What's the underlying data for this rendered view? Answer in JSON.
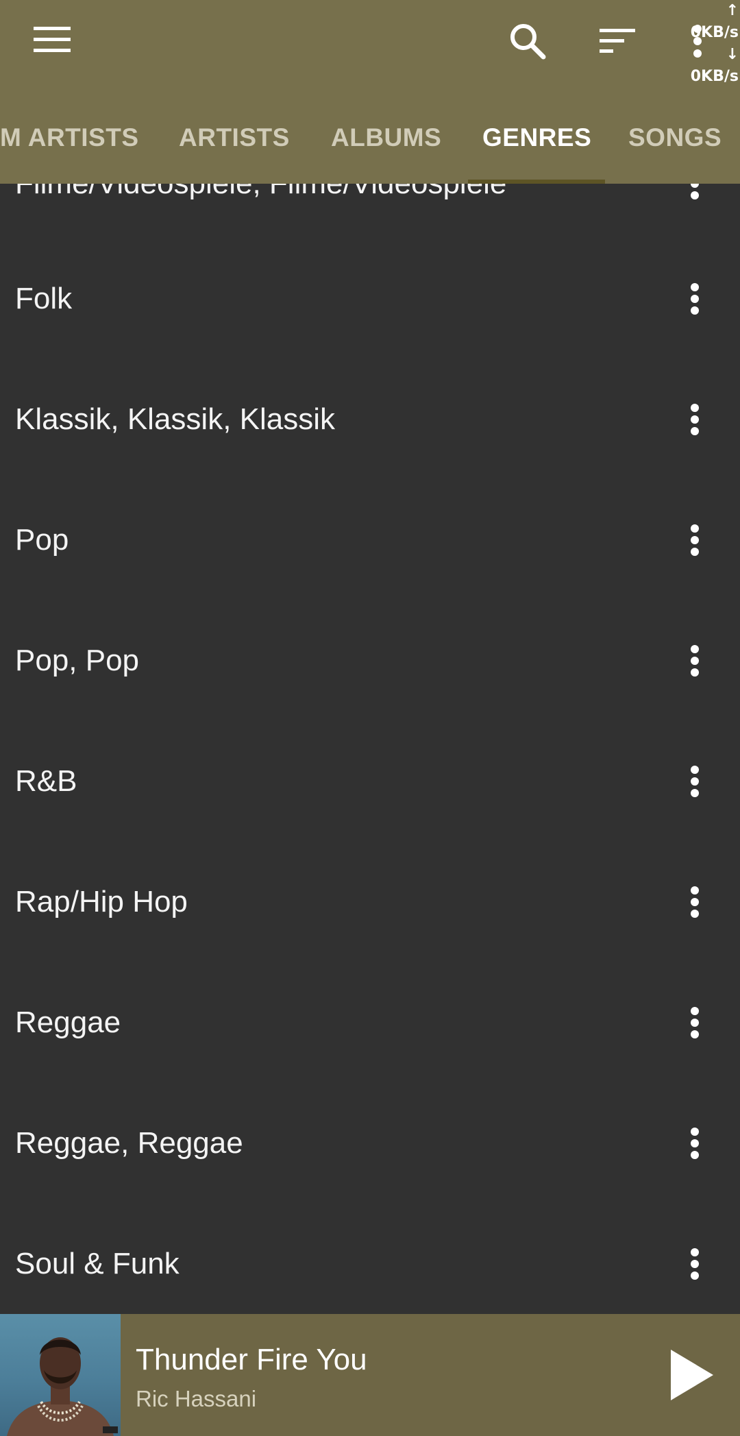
{
  "status": {
    "upload_speed": "↑ 0KB/s",
    "download_speed": "↓ 0KB/s"
  },
  "toolbar": {
    "menu_icon": "hamburger-menu-icon",
    "search_icon": "search-icon",
    "sort_icon": "sort-icon",
    "more_icon": "more-vert-icon"
  },
  "tabs": [
    {
      "label": "M ARTISTS"
    },
    {
      "label": "ARTISTS"
    },
    {
      "label": "ALBUMS"
    },
    {
      "label": "GENRES",
      "active": true
    },
    {
      "label": "SONGS"
    }
  ],
  "genres": [
    {
      "label": "Filme/Videospiele, Filme/Videospiele"
    },
    {
      "label": "Folk"
    },
    {
      "label": "Klassik, Klassik, Klassik"
    },
    {
      "label": "Pop"
    },
    {
      "label": "Pop, Pop"
    },
    {
      "label": "R&B"
    },
    {
      "label": "Rap/Hip Hop"
    },
    {
      "label": "Reggae"
    },
    {
      "label": "Reggae, Reggae"
    },
    {
      "label": "Soul & Funk"
    }
  ],
  "now_playing": {
    "title": "Thunder Fire You",
    "artist": "Ric Hassani",
    "play_icon": "play-icon"
  },
  "colors": {
    "app_bar": "#77704c",
    "list_background": "#313131",
    "player_bar": "#6e6645",
    "tab_indicator": "#5d5425"
  }
}
